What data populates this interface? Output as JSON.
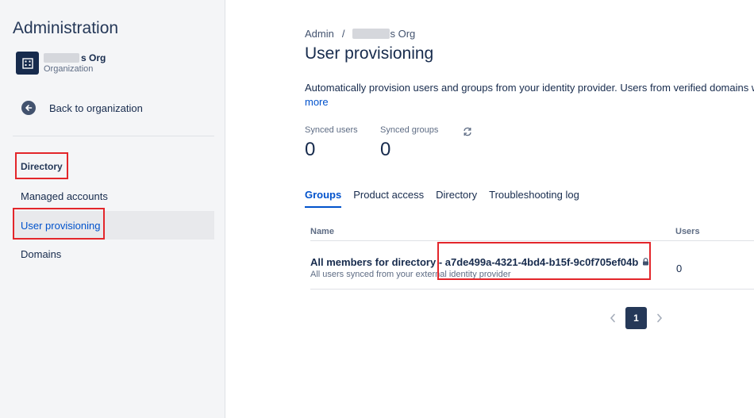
{
  "sidebar": {
    "title": "Administration",
    "org_name_suffix": "s Org",
    "org_type": "Organization",
    "back_label": "Back to organization",
    "nav": {
      "heading": "Directory",
      "items": [
        {
          "label": "Managed accounts"
        },
        {
          "label": "User provisioning",
          "selected": true
        },
        {
          "label": "Domains"
        }
      ]
    }
  },
  "main": {
    "breadcrumb": {
      "root": "Admin",
      "separator": "/",
      "org_suffix": "s Org"
    },
    "title": "User provisioning",
    "description": "Automatically provision users and groups from your identity provider. Users from verified domains will",
    "more_link": "more",
    "stats": [
      {
        "label": "Synced users",
        "value": "0"
      },
      {
        "label": "Synced groups",
        "value": "0"
      }
    ],
    "tabs": [
      {
        "label": "Groups",
        "active": true
      },
      {
        "label": "Product access"
      },
      {
        "label": "Directory"
      },
      {
        "label": "Troubleshooting log"
      }
    ],
    "table": {
      "columns": [
        "Name",
        "Users"
      ],
      "rows": [
        {
          "name": "All members for directory - a7de499a-4321-4bd4-b15f-9c0f705ef04b",
          "description": "All users synced from your external identity provider",
          "users": "0"
        }
      ]
    },
    "pagination": {
      "current_page": "1"
    }
  },
  "colors": {
    "accent": "#0052cc",
    "text": "#172b4d",
    "sidebar_bg": "#f4f5f7",
    "highlight": "#e3262b",
    "selected_bg": "#e8e9ec"
  },
  "icons": [
    "org-building-icon",
    "back-arrow-icon",
    "refresh-icon",
    "lock-icon",
    "chevron-left-icon",
    "chevron-right-icon"
  ]
}
